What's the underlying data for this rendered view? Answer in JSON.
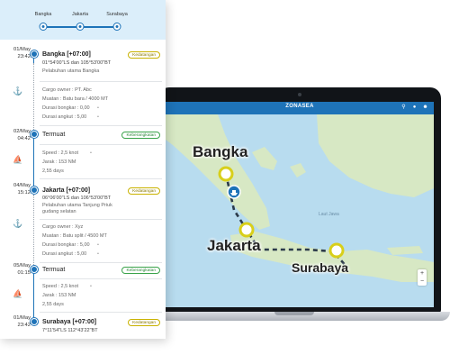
{
  "stepper": [
    "Bangka",
    "Jakarta",
    "Surabaya"
  ],
  "app": {
    "title": "ZONASEA"
  },
  "map": {
    "places": [
      "Bangka",
      "Jakarta",
      "Surabaya"
    ],
    "sea_label": "Laut Jawa",
    "route_color": "#2b3a4a",
    "node_color": "#d8cf1a",
    "ship_color": "#1e73b8"
  },
  "timeline": [
    {
      "date": "01/May",
      "time": "23:42",
      "title": "Bangka [+07:00]",
      "badge": "Kedatangan",
      "coords": "01°54'00\"LS dan 105°53'00\"BT",
      "port": "Pelabuhan utama Bangka",
      "details": [
        "Cargo owner : PT. Abc",
        "Muatan : Batu bara / 4000 MT",
        "Durasi bongkar : 0,00",
        "Durasi angkut : 5,00"
      ]
    },
    {
      "date": "02/May",
      "time": "04:42",
      "title": "Termuat",
      "badge": "Keberangkatan",
      "details": [
        "Speed : 2,5 knot",
        "Jarak : 153 NM",
        "2,55 days"
      ]
    },
    {
      "date": "04/May",
      "time": "15:12",
      "title": "Jakarta [+07:00]",
      "badge": "Kedatangan",
      "coords": "06°06'00\"LS dan 106°53'00\"BT",
      "port": "Pelabuhan utama Tanjung Priuk gudang selatan",
      "details": [
        "Cargo owner : Xyz",
        "Muatan : Batu split / 4500 MT",
        "Durasi bongkar : 5,00",
        "Durasi angkut : 5,00"
      ]
    },
    {
      "date": "05/May",
      "time": "01:15",
      "title": "Termuat",
      "badge": "Keberangkatan",
      "details": [
        "Speed : 2,5 knot",
        "Jarak : 153 NM",
        "2,55 days"
      ]
    },
    {
      "date": "01/May",
      "time": "23:42",
      "title": "Surabaya [+07:00]",
      "badge": "Kedatangan",
      "coords": "7°11'54\"LS 112°43'22\"BT"
    }
  ]
}
